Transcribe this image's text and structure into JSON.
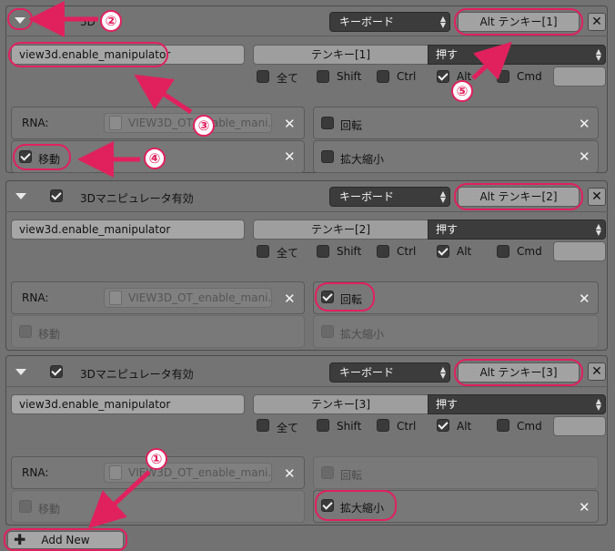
{
  "blocks": [
    {
      "title": "3Dマニピュレータ有効",
      "title_visible": "3D",
      "enabled": null,
      "input_type": "キーボード",
      "key_label": "Alt テンキー[1]",
      "operator": "view3d.enable_manipulator",
      "key_button": "テンキー[1]",
      "event": "押す",
      "modifiers": {
        "all": "全て",
        "shift": "Shift",
        "ctrl": "Ctrl",
        "alt": "Alt",
        "cmd": "Cmd"
      },
      "modifier_states": {
        "all": false,
        "shift": false,
        "ctrl": false,
        "alt": true,
        "cmd": false
      },
      "rna_label": "RNA:",
      "rna_value": "VIEW3D_OT_enable_mani...",
      "rotate_label": "回転",
      "rotate": false,
      "move_label": "移動",
      "move": true,
      "scale_label": "拡大縮小",
      "scale": false,
      "move_enabled": true,
      "rotate_enabled": true,
      "scale_enabled": true
    },
    {
      "title": "3Dマニピュレータ有効",
      "enabled": true,
      "input_type": "キーボード",
      "key_label": "Alt テンキー[2]",
      "operator": "view3d.enable_manipulator",
      "key_button": "テンキー[2]",
      "event": "押す",
      "modifiers": {
        "all": "全て",
        "shift": "Shift",
        "ctrl": "Ctrl",
        "alt": "Alt",
        "cmd": "Cmd"
      },
      "modifier_states": {
        "all": false,
        "shift": false,
        "ctrl": false,
        "alt": true,
        "cmd": false
      },
      "rna_label": "RNA:",
      "rna_value": "VIEW3D_OT_enable_mani...",
      "rotate_label": "回転",
      "rotate": true,
      "move_label": "移動",
      "move": false,
      "scale_label": "拡大縮小",
      "scale": false,
      "move_enabled": false,
      "rotate_enabled": true,
      "scale_enabled": false
    },
    {
      "title": "3Dマニピュレータ有効",
      "enabled": true,
      "input_type": "キーボード",
      "key_label": "Alt テンキー[3]",
      "operator": "view3d.enable_manipulator",
      "key_button": "テンキー[3]",
      "event": "押す",
      "modifiers": {
        "all": "全て",
        "shift": "Shift",
        "ctrl": "Ctrl",
        "alt": "Alt",
        "cmd": "Cmd"
      },
      "modifier_states": {
        "all": false,
        "shift": false,
        "ctrl": false,
        "alt": true,
        "cmd": false
      },
      "rna_label": "RNA:",
      "rna_value": "VIEW3D_OT_enable_mani...",
      "rotate_label": "回転",
      "rotate": false,
      "move_label": "移動",
      "move": false,
      "scale_label": "拡大縮小",
      "scale": true,
      "move_enabled": false,
      "rotate_enabled": false,
      "scale_enabled": true
    }
  ],
  "add_new_label": "Add New",
  "annotations": {
    "badge_1": "①",
    "badge_2": "②",
    "badge_3": "③",
    "badge_4": "④",
    "badge_5": "⑤",
    "highlight_color": "#e0215e"
  }
}
